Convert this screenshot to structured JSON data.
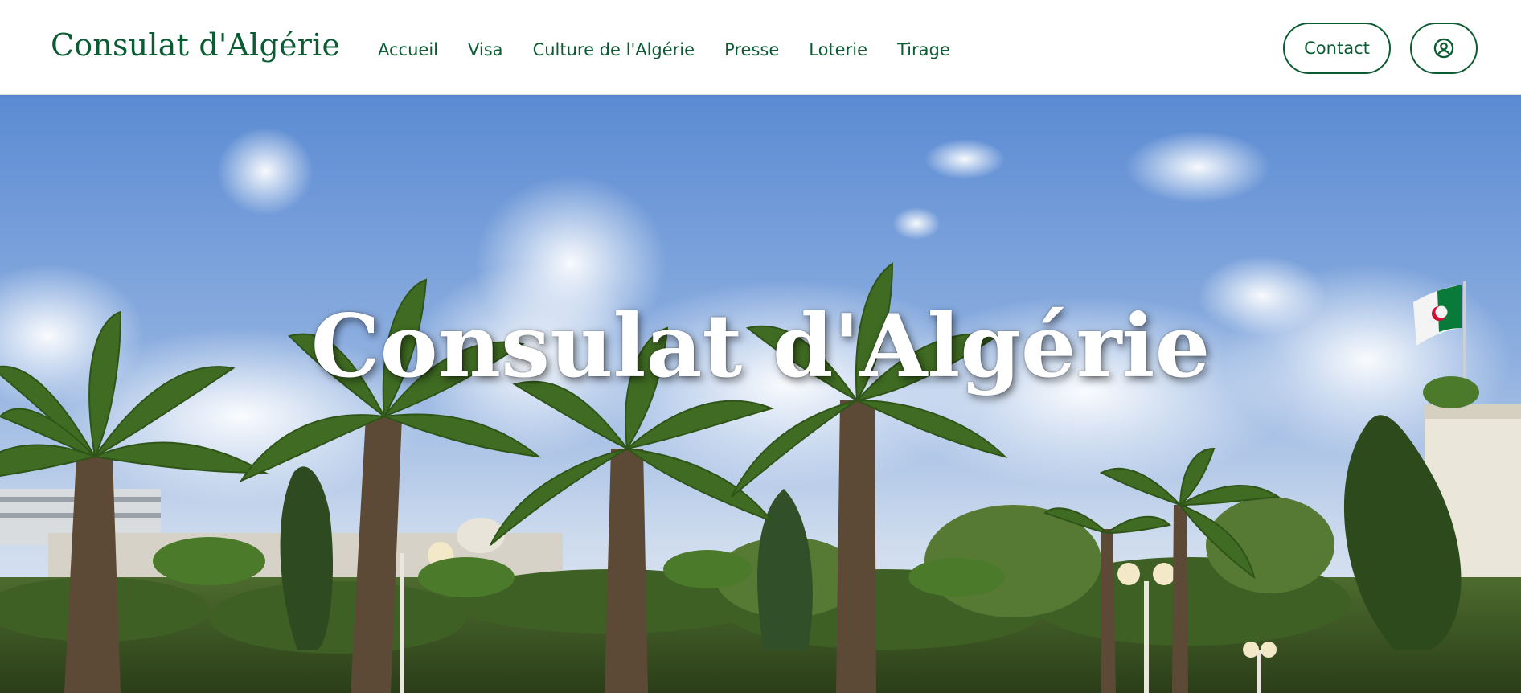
{
  "header": {
    "brand": "Consulat d'Algérie",
    "nav": [
      {
        "label": "Accueil"
      },
      {
        "label": "Visa"
      },
      {
        "label": "Culture de l'Algérie"
      },
      {
        "label": "Presse"
      },
      {
        "label": "Loterie"
      },
      {
        "label": "Tirage"
      }
    ],
    "contact_label": "Contact",
    "account_icon": "user-circle-icon"
  },
  "hero": {
    "title": "Consulat d'Algérie",
    "background": "photo of palm trees, gardens and Algerian flag under blue sky with clouds"
  },
  "colors": {
    "brand_green": "#0b5c33",
    "header_bg": "#ffffff",
    "sky_top": "#5f8fd6",
    "sky_bottom": "#c9d9ee",
    "flag_green": "#0a7a3a",
    "flag_red": "#d21034"
  }
}
